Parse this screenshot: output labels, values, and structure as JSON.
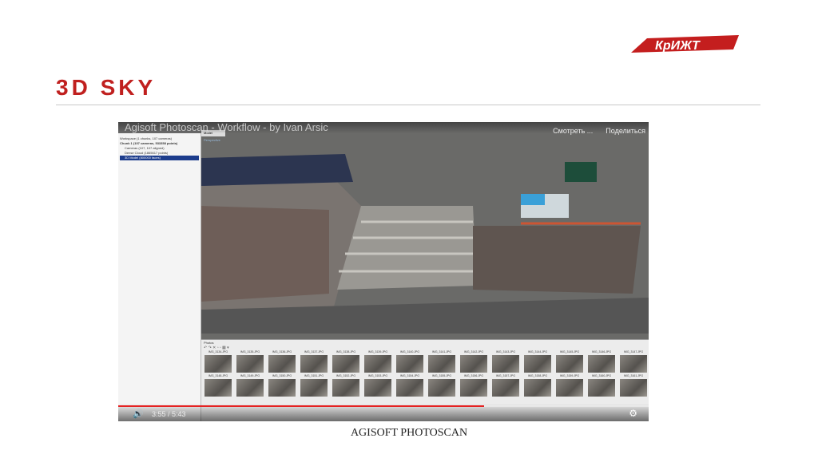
{
  "slide": {
    "title": "3D SKY",
    "logo_text": "КрИЖТ",
    "caption": "AGISOFT PHOTOSCAN"
  },
  "video": {
    "title": "Agisoft Photoscan - Workflow - by Ivan Arsic",
    "actions": [
      "Смотреть ...",
      "Поделиться"
    ],
    "time": "3:55 / 5:43",
    "progress": 0.69,
    "tree": [
      "Workspace (1 chunks, 107 cameras)",
      "Chunk 1 (107 cameras, 533358 points)",
      "Cameras (107, 107 aligned)",
      "Dense Cloud (1865617 points)",
      "3D Model (800000 faces)"
    ],
    "model_tab": "Model",
    "view_label": "Perspective",
    "photos_header": "Photos",
    "photos_row1": [
      "IMG_3134.JPG",
      "IMG_3135.JPG",
      "IMG_3136.JPG",
      "IMG_3137.JPG",
      "IMG_3138.JPG",
      "IMG_3139.JPG",
      "IMG_3140.JPG",
      "IMG_3141.JPG",
      "IMG_3142.JPG",
      "IMG_3143.JPG",
      "IMG_3144.JPG",
      "IMG_3145.JPG",
      "IMG_3146.JPG",
      "IMG_3147.JPG"
    ],
    "photos_row2": [
      "IMG_3148.JPG",
      "IMG_3149.JPG",
      "IMG_3150.JPG",
      "IMG_3151.JPG",
      "IMG_3152.JPG",
      "IMG_3153.JPG",
      "IMG_3154.JPG",
      "IMG_3155.JPG",
      "IMG_3156.JPG",
      "IMG_3157.JPG",
      "IMG_3158.JPG",
      "IMG_3159.JPG",
      "IMG_3160.JPG",
      "IMG_3161.JPG"
    ]
  }
}
